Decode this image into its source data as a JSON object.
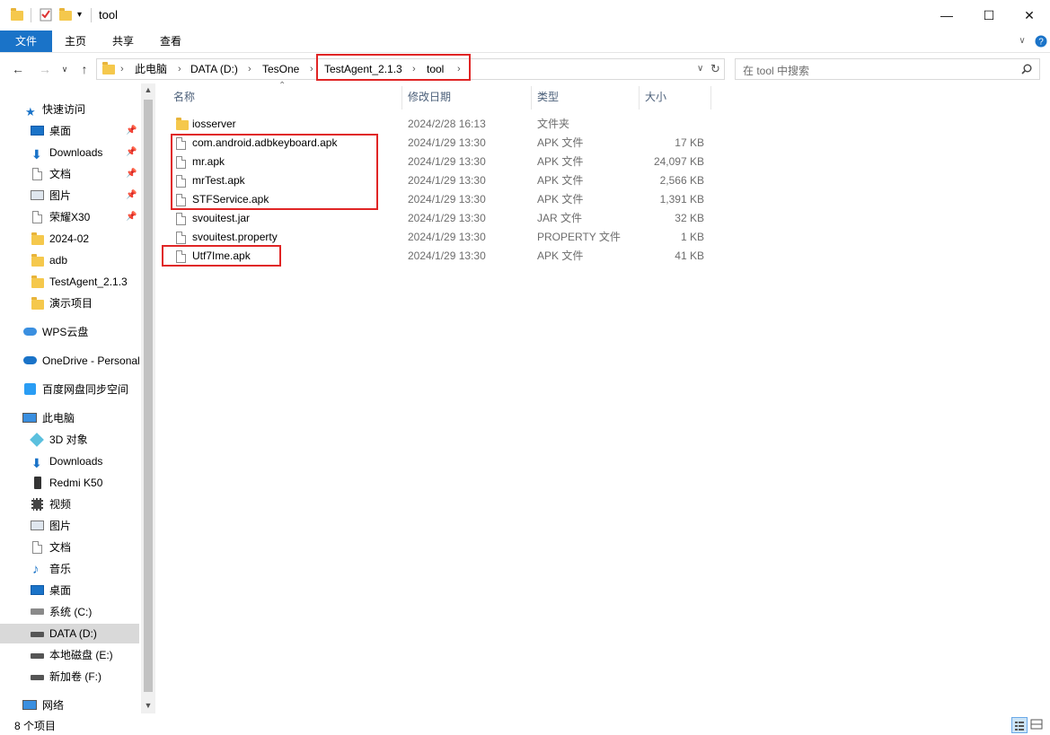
{
  "window": {
    "title": "tool"
  },
  "ribbon": {
    "tabs": [
      "文件",
      "主页",
      "共享",
      "查看"
    ]
  },
  "address": {
    "crumbs": [
      "此电脑",
      "DATA (D:)",
      "TesOne",
      "TestAgent_2.1.3",
      "tool"
    ],
    "search_placeholder": "在 tool 中搜索"
  },
  "sidebar": {
    "quick_access": "快速访问",
    "quick_items": [
      "桌面",
      "Downloads",
      "文档",
      "图片",
      "荣耀X30",
      "2024-02",
      "adb",
      "TestAgent_2.1.3",
      "演示项目"
    ],
    "wps": "WPS云盘",
    "onedrive": "OneDrive - Personal",
    "baidu": "百度网盘同步空间",
    "this_pc": "此电脑",
    "pc_items": [
      "3D 对象",
      "Downloads",
      "Redmi K50",
      "视频",
      "图片",
      "文档",
      "音乐",
      "桌面",
      "系统 (C:)",
      "DATA (D:)",
      "本地磁盘 (E:)",
      "新加卷 (F:)"
    ],
    "network": "网络"
  },
  "columns": {
    "name": "名称",
    "date": "修改日期",
    "type": "类型",
    "size": "大小"
  },
  "files": [
    {
      "name": "iosserver",
      "date": "2024/2/28 16:13",
      "type": "文件夹",
      "size": "",
      "kind": "folder"
    },
    {
      "name": "com.android.adbkeyboard.apk",
      "date": "2024/1/29 13:30",
      "type": "APK 文件",
      "size": "17 KB",
      "kind": "file"
    },
    {
      "name": "mr.apk",
      "date": "2024/1/29 13:30",
      "type": "APK 文件",
      "size": "24,097 KB",
      "kind": "file"
    },
    {
      "name": "mrTest.apk",
      "date": "2024/1/29 13:30",
      "type": "APK 文件",
      "size": "2,566 KB",
      "kind": "file"
    },
    {
      "name": "STFService.apk",
      "date": "2024/1/29 13:30",
      "type": "APK 文件",
      "size": "1,391 KB",
      "kind": "file"
    },
    {
      "name": "svouitest.jar",
      "date": "2024/1/29 13:30",
      "type": "JAR 文件",
      "size": "32 KB",
      "kind": "file"
    },
    {
      "name": "svouitest.property",
      "date": "2024/1/29 13:30",
      "type": "PROPERTY 文件",
      "size": "1 KB",
      "kind": "file"
    },
    {
      "name": "Utf7Ime.apk",
      "date": "2024/1/29 13:30",
      "type": "APK 文件",
      "size": "41 KB",
      "kind": "file"
    }
  ],
  "status": {
    "count": "8 个项目"
  },
  "colors": {
    "accent": "#1a73c8",
    "highlight": "#e02525",
    "folder": "#f5c84c"
  }
}
